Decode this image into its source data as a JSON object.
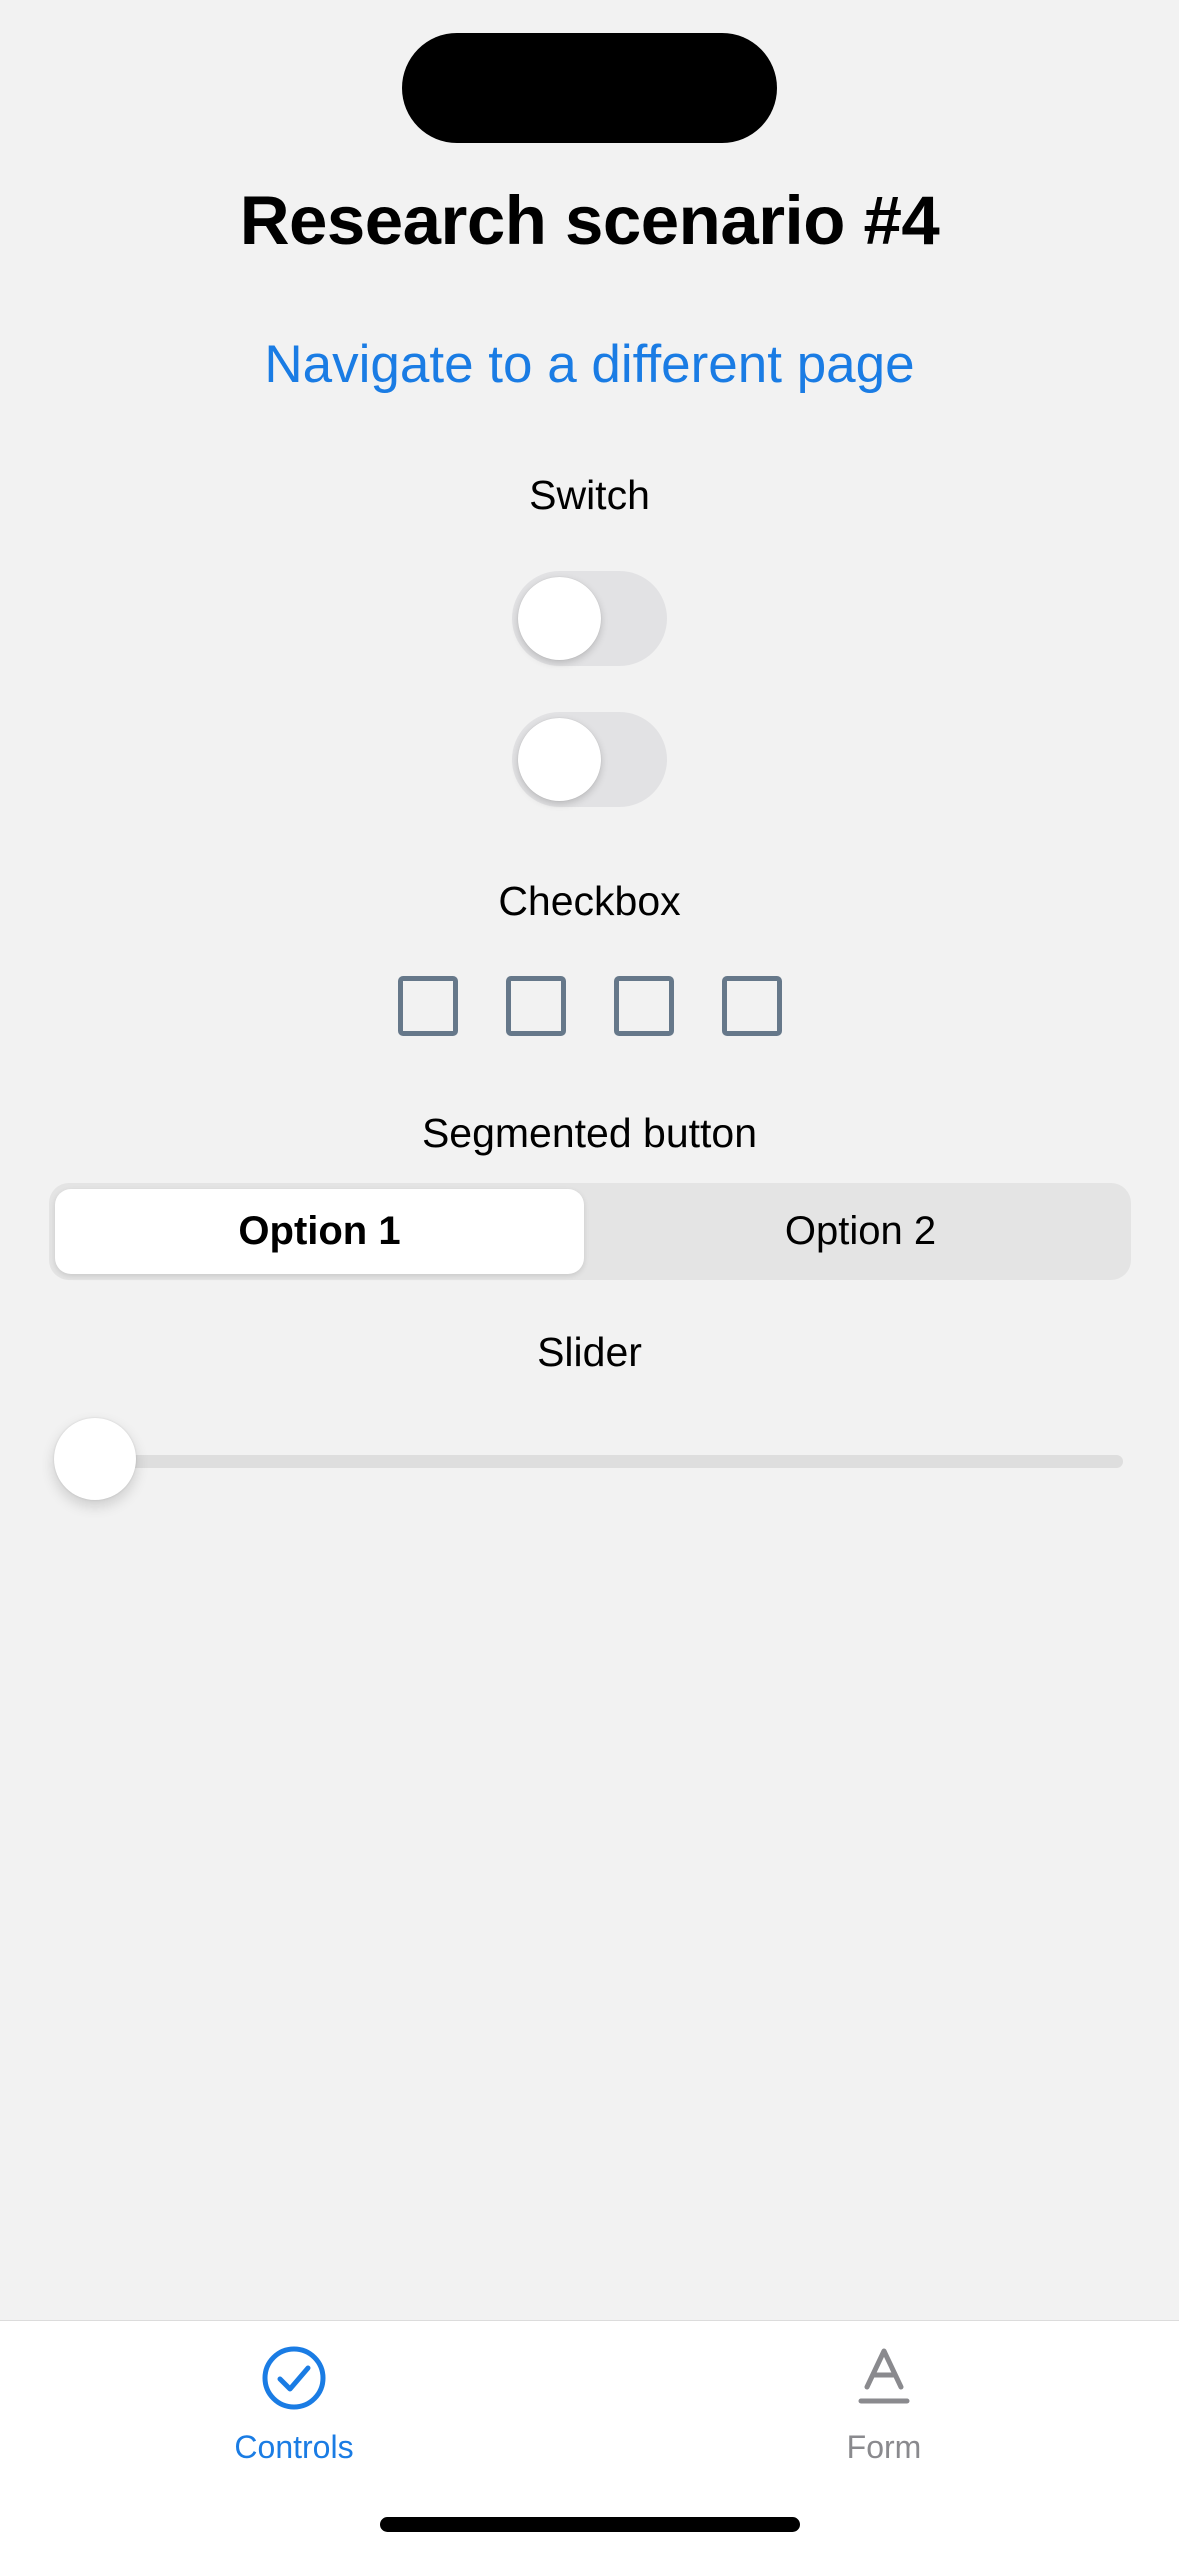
{
  "page": {
    "title": "Research scenario #4",
    "nav_link": "Navigate to a different page"
  },
  "switch_section": {
    "label": "Switch",
    "switches": [
      {
        "state": "off"
      },
      {
        "state": "off"
      }
    ]
  },
  "checkbox_section": {
    "label": "Checkbox",
    "checkboxes": [
      {
        "checked": false
      },
      {
        "checked": false
      },
      {
        "checked": false
      },
      {
        "checked": false
      }
    ]
  },
  "segmented_section": {
    "label": "Segmented button",
    "options": [
      "Option 1",
      "Option 2"
    ],
    "selected": "Option 1"
  },
  "slider_section": {
    "label": "Slider",
    "value_fraction": 0
  },
  "tab_bar": {
    "tabs": [
      {
        "label": "Controls",
        "icon": "checkmark-circle-icon",
        "active": true
      },
      {
        "label": "Form",
        "icon": "text-format-icon",
        "active": false
      }
    ]
  },
  "colors": {
    "accent": "#1a7ce4",
    "background": "#f2f2f2",
    "inactive_tab": "#8a8a8e",
    "checkbox_border": "#66788a"
  }
}
